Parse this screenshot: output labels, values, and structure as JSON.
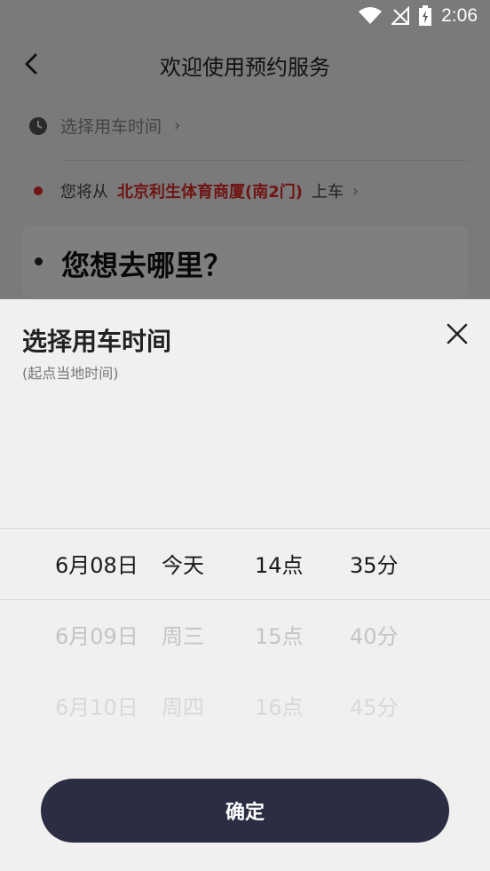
{
  "status": {
    "time": "2:06"
  },
  "nav": {
    "title": "欢迎使用预约服务"
  },
  "booking": {
    "time_label": "选择用车时间",
    "chevron": "›",
    "origin_prefix": "您将从",
    "origin_place": "北京利生体育商厦(南2门)",
    "origin_suffix": "上车",
    "destination_prompt": "您想去哪里？"
  },
  "sheet": {
    "title": "选择用车时间",
    "subtitle": "(起点当地时间)",
    "picker": {
      "rows": [
        {
          "date": "6月08日",
          "day": "今天",
          "hour": "14点",
          "minute": "35分"
        },
        {
          "date": "6月09日",
          "day": "周三",
          "hour": "15点",
          "minute": "40分"
        },
        {
          "date": "6月10日",
          "day": "周四",
          "hour": "16点",
          "minute": "45分"
        }
      ]
    },
    "confirm_label": "确定"
  },
  "colors": {
    "accent_red": "#e02828",
    "button_dark": "#2b2d42"
  },
  "icons": [
    "wifi-icon",
    "signal-icon",
    "battery-icon",
    "back-arrow-icon",
    "clock-icon",
    "close-icon"
  ]
}
